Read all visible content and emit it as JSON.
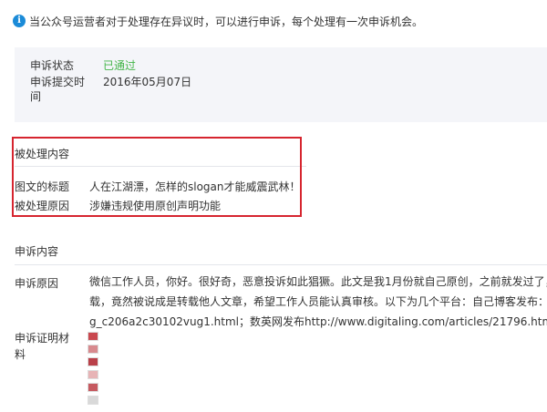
{
  "notice": {
    "text": "当公众号运营者对于处理存在异议时，可以进行申诉，每个处理有一次申诉机会。"
  },
  "status": {
    "label": "申诉状态",
    "value": "已通过",
    "value_color": "#44b549",
    "submit_label_line1": "申诉提交时",
    "submit_label_line2": "间",
    "submit_value": "2016年05月07日"
  },
  "processed": {
    "heading": "被处理内容",
    "title_label": "图文的标题",
    "title_value": "人在江湖漂，怎样的slogan才能威震武林！",
    "reason_label": "被处理原因",
    "reason_value": "涉嫌违规使用原创声明功能",
    "highlight_color": "#d6252f"
  },
  "appeal": {
    "heading": "申诉内容",
    "reason_label": "申诉原因",
    "reason_lines": [
      "微信工作人员，你好。很好奇，恶意投诉如此猖獗。此文是我1月份就自己原创，之前就发过了，",
      "载，竟然被说成是转载他人文章，希望工作人员能认真审核。以下为几个平台：自己博客发布：h",
      "g_c206a2c30102vug1.html；数英网发布http://www.digitaling.com/articles/21796.html"
    ],
    "evidence_label_line1": "申诉证明材",
    "evidence_label_line2": "料",
    "evidence_thumbs": [
      "#c9484f",
      "#d88a8e",
      "#b94049",
      "#e7b4b6",
      "#c65a60",
      "#d9d9d9"
    ]
  }
}
